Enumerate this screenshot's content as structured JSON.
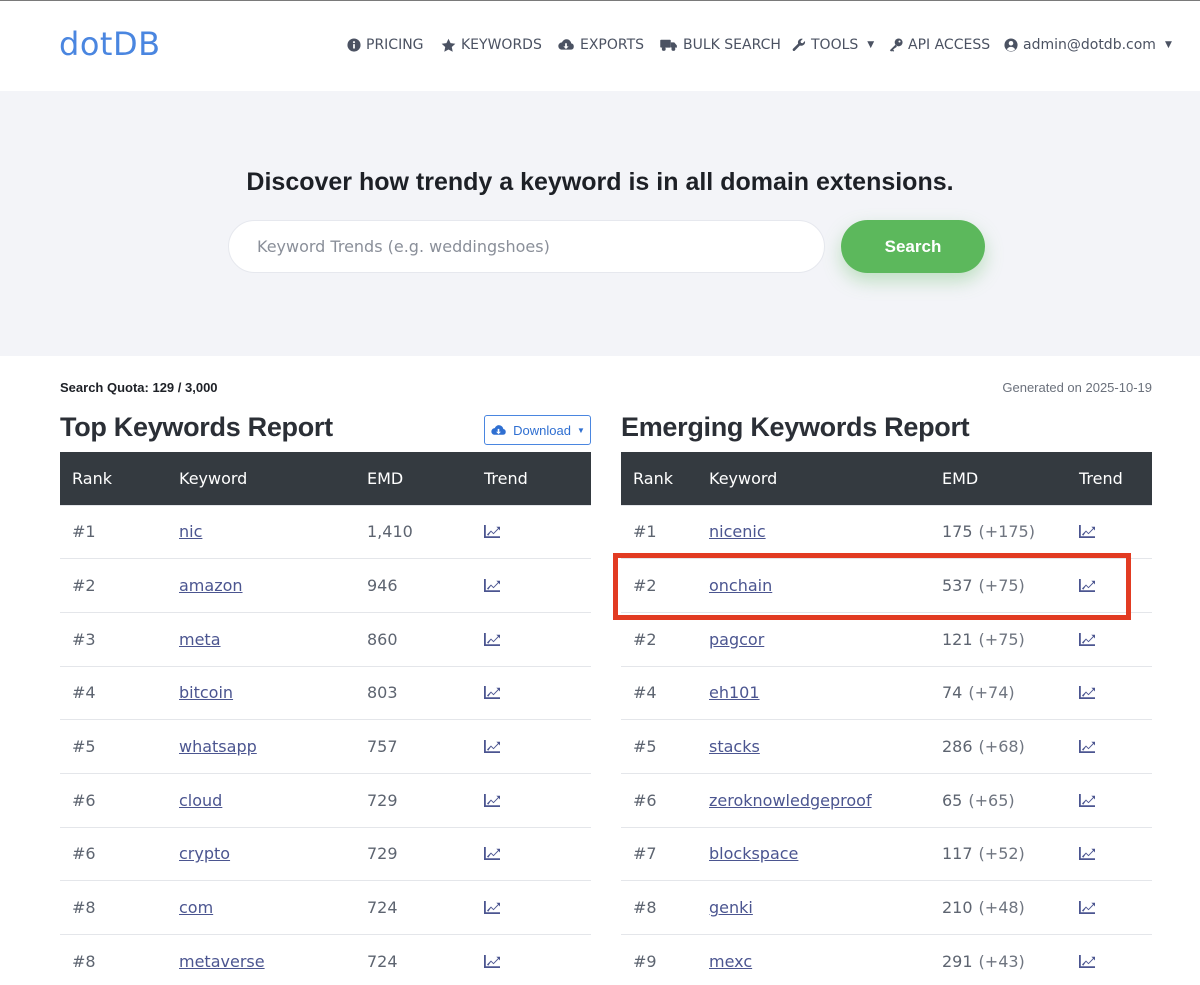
{
  "header": {
    "logo": "dotDB",
    "nav": [
      {
        "label": "PRICING",
        "icon": "info-circle-icon"
      },
      {
        "label": "KEYWORDS",
        "icon": "star-icon"
      },
      {
        "label": "EXPORTS",
        "icon": "cloud-download-icon"
      },
      {
        "label": "BULK SEARCH",
        "icon": "truck-icon"
      },
      {
        "label": "TOOLS",
        "icon": "wrench-icon"
      },
      {
        "label": "API ACCESS",
        "icon": "key-icon"
      },
      {
        "label": "admin@dotdb.com",
        "icon": "user-circle-icon"
      }
    ]
  },
  "hero": {
    "title": "Discover how trendy a keyword is in all domain extensions.",
    "search_placeholder": "Keyword Trends (e.g. weddingshoes)",
    "search_button": "Search"
  },
  "quota": "Search Quota: 129 / 3,000",
  "generated": "Generated on 2025-10-19",
  "top_report": {
    "title": "Top Keywords Report",
    "download_label": "Download",
    "columns": [
      "Rank",
      "Keyword",
      "EMD",
      "Trend"
    ],
    "rows": [
      {
        "rank": "#1",
        "keyword": "nic",
        "emd": "1,410"
      },
      {
        "rank": "#2",
        "keyword": "amazon",
        "emd": "946"
      },
      {
        "rank": "#3",
        "keyword": "meta",
        "emd": "860"
      },
      {
        "rank": "#4",
        "keyword": "bitcoin",
        "emd": "803"
      },
      {
        "rank": "#5",
        "keyword": "whatsapp",
        "emd": "757"
      },
      {
        "rank": "#6",
        "keyword": "cloud",
        "emd": "729"
      },
      {
        "rank": "#6",
        "keyword": "crypto",
        "emd": "729"
      },
      {
        "rank": "#8",
        "keyword": "com",
        "emd": "724"
      },
      {
        "rank": "#8",
        "keyword": "metaverse",
        "emd": "724"
      }
    ]
  },
  "emerging_report": {
    "title": "Emerging Keywords Report",
    "columns": [
      "Rank",
      "Keyword",
      "EMD",
      "Trend"
    ],
    "rows": [
      {
        "rank": "#1",
        "keyword": "nicenic",
        "emd": "175",
        "delta": "(+175)"
      },
      {
        "rank": "#2",
        "keyword": "onchain",
        "emd": "537",
        "delta": "(+75)"
      },
      {
        "rank": "#2",
        "keyword": "pagcor",
        "emd": "121",
        "delta": "(+75)"
      },
      {
        "rank": "#4",
        "keyword": "eh101",
        "emd": "74",
        "delta": "(+74)"
      },
      {
        "rank": "#5",
        "keyword": "stacks",
        "emd": "286",
        "delta": "(+68)"
      },
      {
        "rank": "#6",
        "keyword": "zeroknowledgeproof",
        "emd": "65",
        "delta": "(+65)"
      },
      {
        "rank": "#7",
        "keyword": "blockspace",
        "emd": "117",
        "delta": "(+52)"
      },
      {
        "rank": "#8",
        "keyword": "genki",
        "emd": "210",
        "delta": "(+48)"
      },
      {
        "rank": "#9",
        "keyword": "mexc",
        "emd": "291",
        "delta": "(+43)"
      }
    ]
  },
  "colors": {
    "brand": "#4a86e0",
    "search_button": "#5cb85c",
    "table_header": "#343a40",
    "highlight": "#e23b22",
    "link": "#4b5590"
  }
}
